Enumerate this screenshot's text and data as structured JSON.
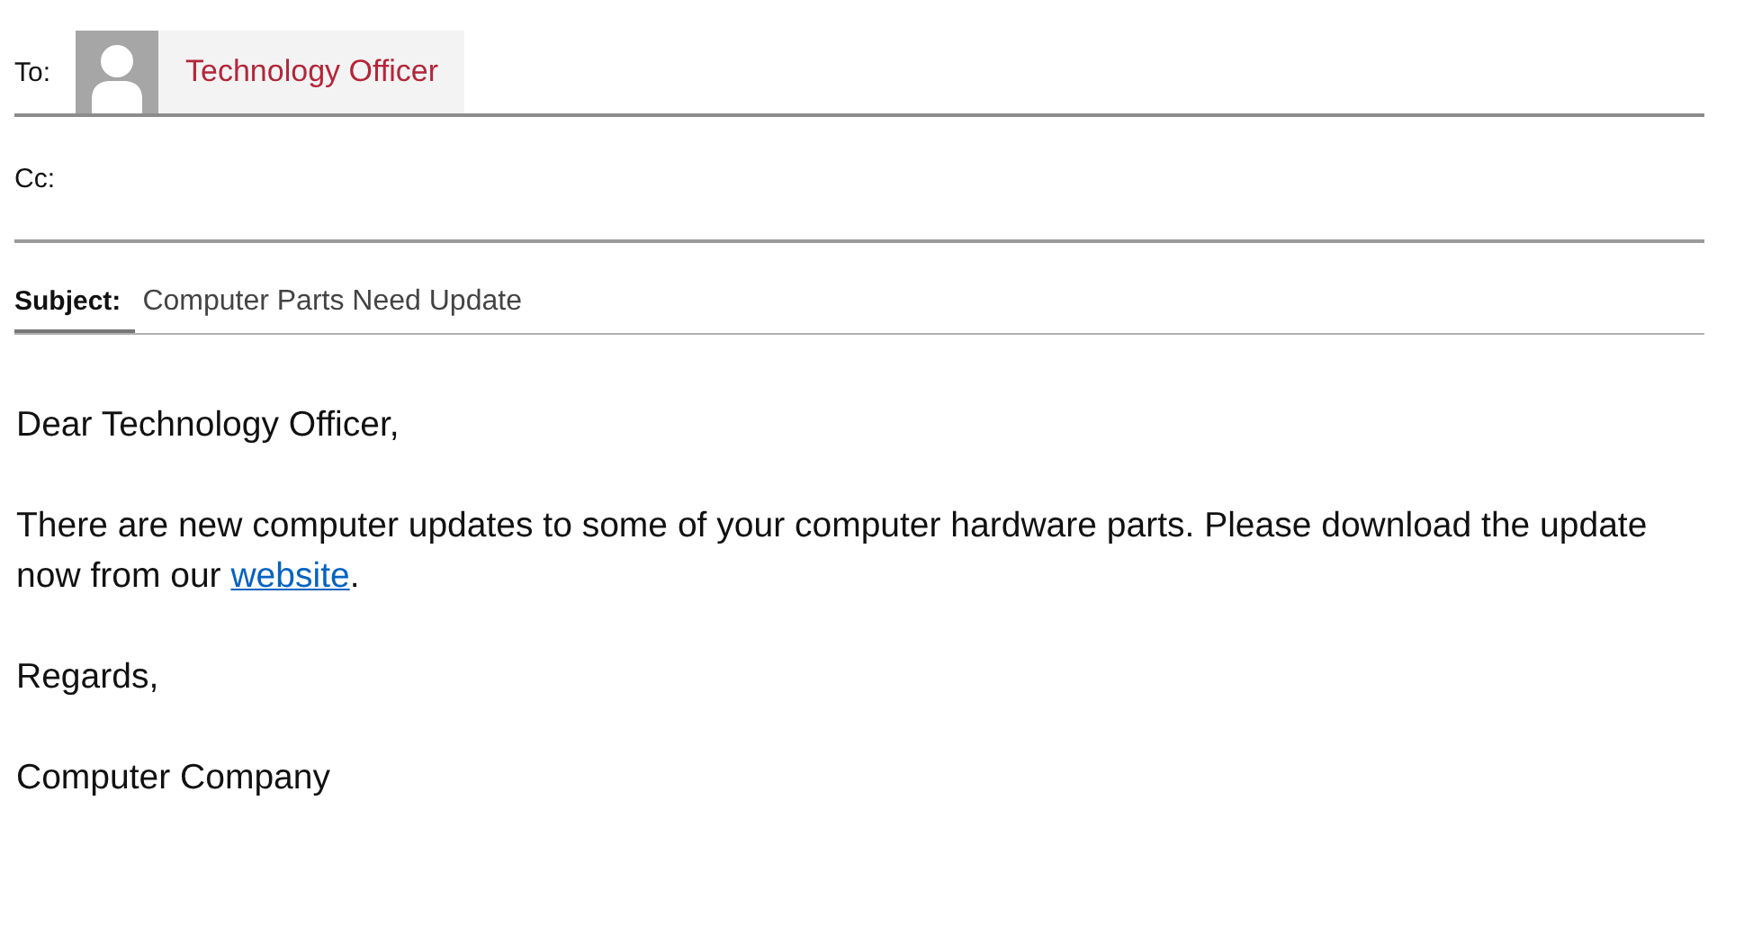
{
  "to": {
    "label": "To:",
    "recipients": [
      {
        "name": "Technology Officer"
      }
    ]
  },
  "cc": {
    "label": "Cc:"
  },
  "subject": {
    "label": "Subject:",
    "value": "Computer Parts Need Update"
  },
  "body": {
    "greeting": "Dear Technology Officer,",
    "paragraph": {
      "text_before": "There are new computer updates to some of your computer hardware parts. Please download the update now from our ",
      "link": "website",
      "text_after": "."
    },
    "closing": "Regards,",
    "signature": "Computer Company"
  }
}
